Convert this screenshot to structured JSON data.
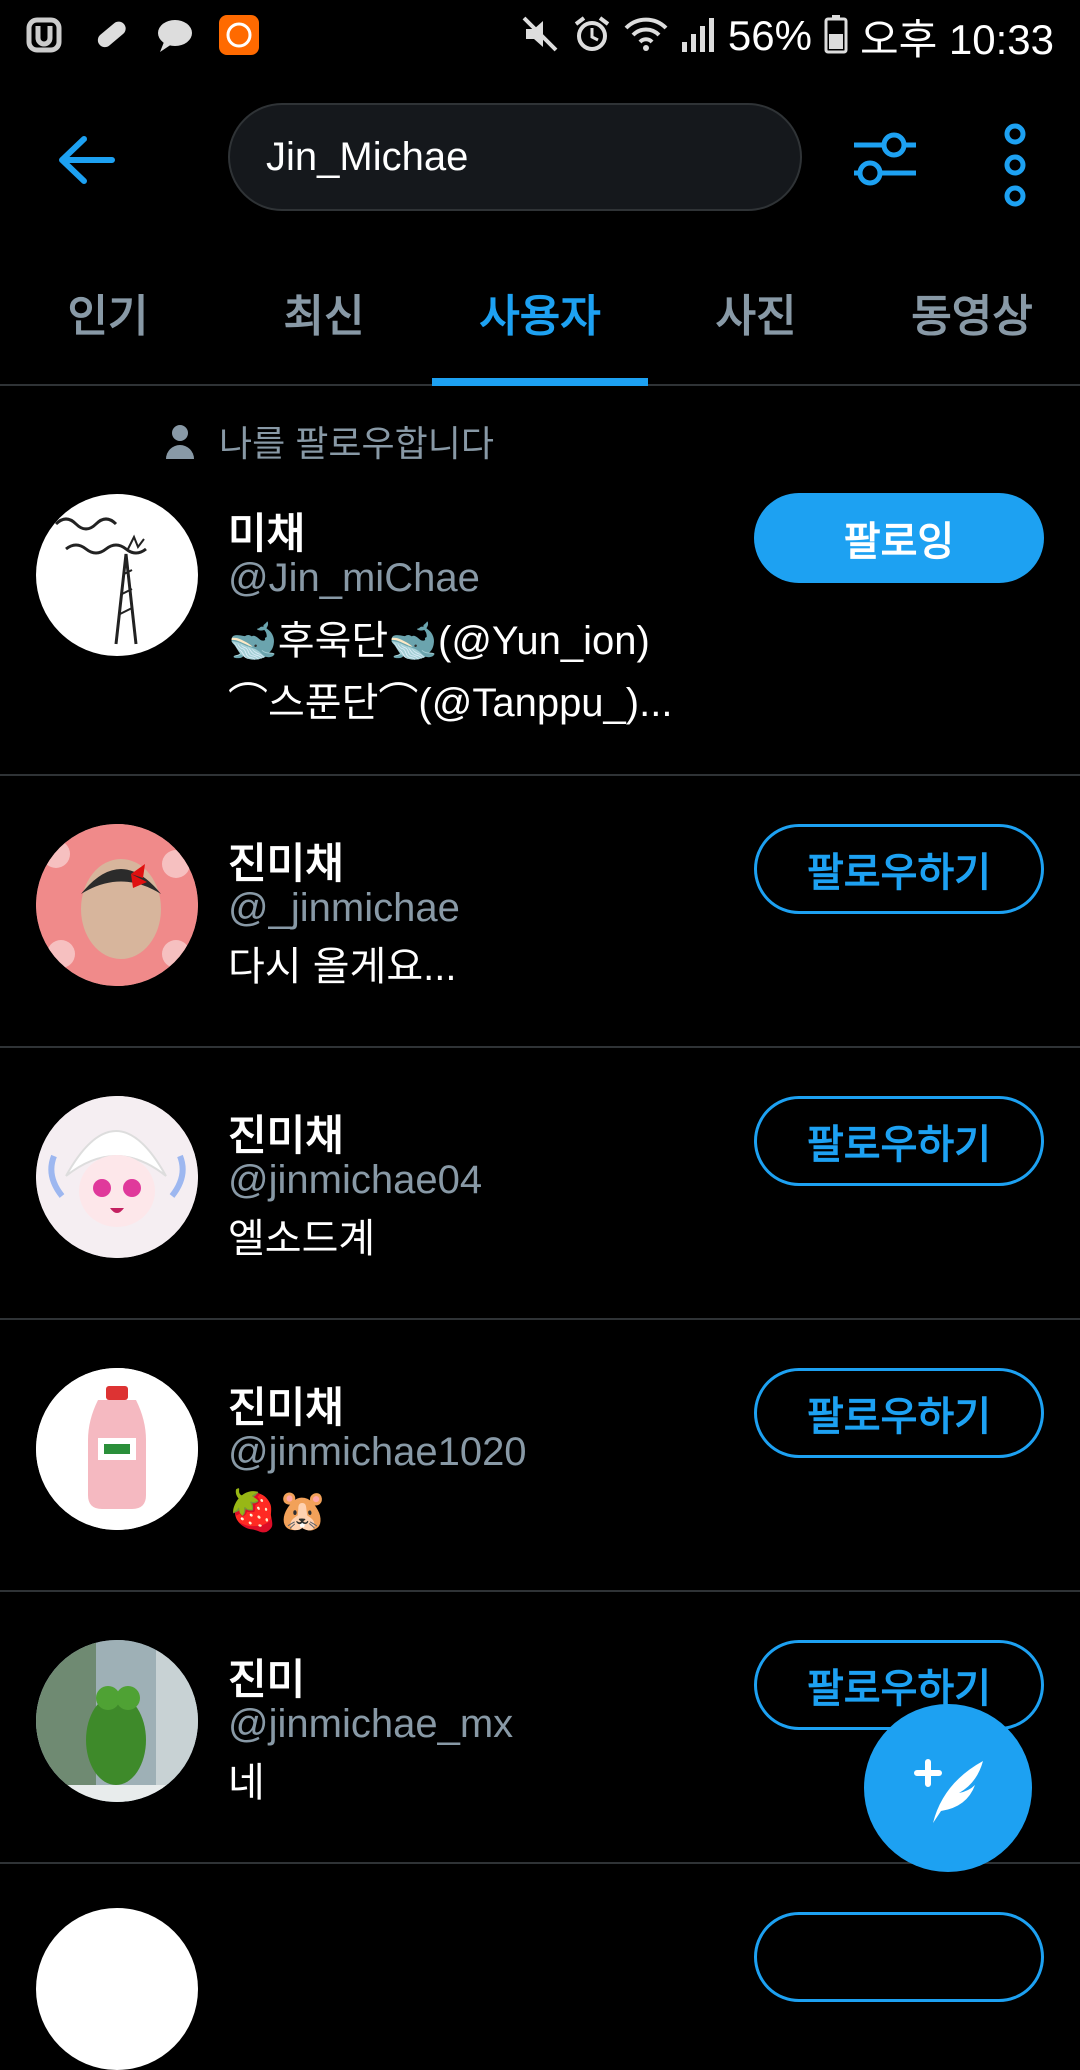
{
  "status_bar": {
    "battery": "56%",
    "time": "오후 10:33"
  },
  "search": {
    "query": "Jin_Michae"
  },
  "tabs": [
    {
      "label": "인기"
    },
    {
      "label": "최신"
    },
    {
      "label": "사용자",
      "active": true
    },
    {
      "label": "사진"
    },
    {
      "label": "동영상"
    }
  ],
  "context": {
    "label": "나를 팔로우합니다"
  },
  "users": [
    {
      "name": "미채",
      "handle": "@Jin_miChae",
      "bio_line1": "🐋후욱단🐋(@Yun_ion)",
      "bio_line2": "⌒스푼단⌒(@Tanppu_)...",
      "button": "팔로잉"
    },
    {
      "name": "진미채",
      "handle": "@_jinmichae",
      "bio_line1": "다시 올게요...",
      "button": "팔로우하기"
    },
    {
      "name": "진미채",
      "handle": "@jinmichae04",
      "bio_line1": "엘소드계",
      "button": "팔로우하기"
    },
    {
      "name": "진미채",
      "handle": "@jinmichae1020",
      "bio_line1": "🍓🐹",
      "button": "팔로우하기"
    },
    {
      "name": "진미",
      "handle": "@jinmichae_mx",
      "bio_line1": "네",
      "button": "팔로우하기"
    }
  ],
  "colors": {
    "accent": "#1da1f2",
    "background": "#000000",
    "muted": "#8899a6",
    "divider": "#2f3336"
  }
}
